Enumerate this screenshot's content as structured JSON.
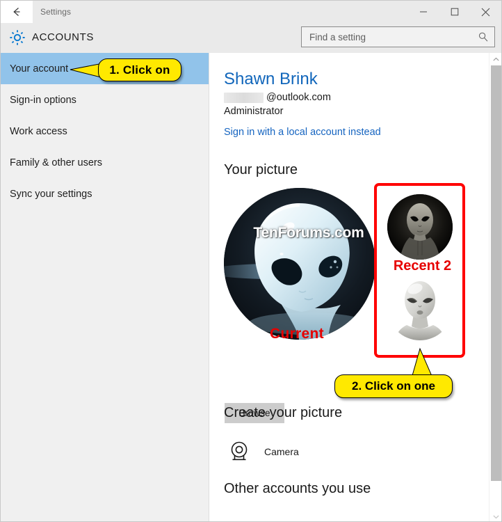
{
  "window": {
    "title": "Settings",
    "back_icon": "back-arrow-icon",
    "minimize_label": "–",
    "maximize_label": "□",
    "close_label": "✕"
  },
  "header": {
    "gear_icon": "gear-icon",
    "page_title": "ACCOUNTS",
    "search": {
      "placeholder": "Find a setting",
      "value": "",
      "icon": "search-icon"
    }
  },
  "sidebar": {
    "items": [
      {
        "label": "Your account",
        "selected": true
      },
      {
        "label": "Sign-in options",
        "selected": false
      },
      {
        "label": "Work access",
        "selected": false
      },
      {
        "label": "Family & other users",
        "selected": false
      },
      {
        "label": "Sync your settings",
        "selected": false
      }
    ]
  },
  "account": {
    "name": "Shawn Brink",
    "email_domain": "@outlook.com",
    "email_redacted": true,
    "role": "Administrator",
    "local_account_link": "Sign in with a local account instead"
  },
  "sections": {
    "your_picture": "Your picture",
    "create_your_picture": "Create your picture",
    "other_accounts": "Other accounts you use"
  },
  "picture": {
    "current_label": "Current",
    "recent_label": "Recent 2",
    "watermark": "TenForums.com",
    "browse_button": "Browse",
    "recent_thumbs": [
      {
        "name": "recent-picture-1"
      },
      {
        "name": "recent-picture-2"
      }
    ]
  },
  "create": {
    "camera_label": "Camera",
    "camera_icon": "camera-icon"
  },
  "annotations": {
    "callout_1": "1. Click on",
    "callout_2": "2. Click on one",
    "highlight_color": "#ff0000",
    "callout_bg": "#ffe900",
    "label_color": "#e60000"
  },
  "scrollbar": {
    "up_arrow": "chevron-up-icon",
    "down_arrow": "chevron-down-icon"
  }
}
